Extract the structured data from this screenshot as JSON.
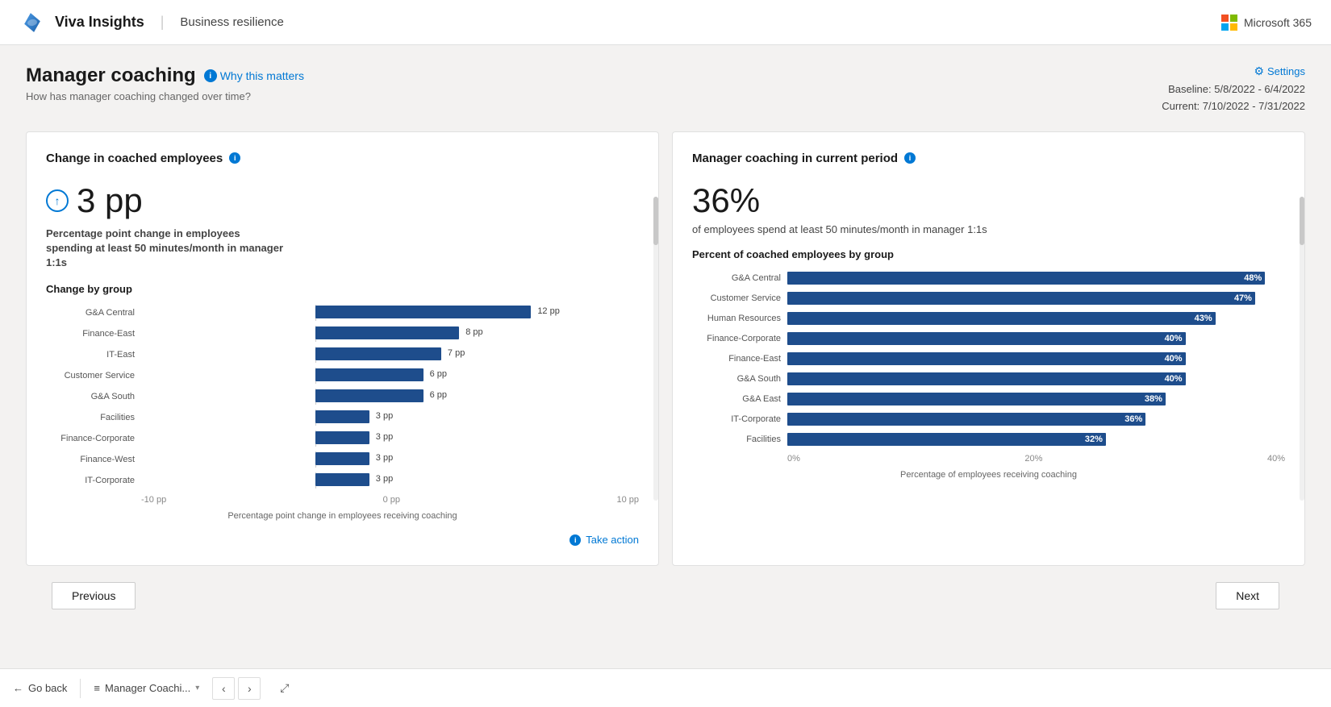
{
  "nav": {
    "app_title": "Viva Insights",
    "section": "Business resilience",
    "ms365_label": "Microsoft 365"
  },
  "header": {
    "title": "Manager coaching",
    "why_matters": "Why this matters",
    "subtitle": "How has manager coaching changed over time?",
    "baseline_label": "Baseline: 5/8/2022 - 6/4/2022",
    "current_label": "Current: 7/10/2022 - 7/31/2022",
    "settings_label": "Settings"
  },
  "left_card": {
    "title": "Change in coached employees",
    "big_value": "3 pp",
    "metric_desc": "Percentage point change in employees spending at least 50 minutes/month in manager 1:1s",
    "change_by_group_title": "Change by group",
    "chart_data": [
      {
        "label": "G&A Central",
        "value": 12,
        "display": "12 pp"
      },
      {
        "label": "Finance-East",
        "value": 8,
        "display": "8 pp"
      },
      {
        "label": "IT-East",
        "value": 7,
        "display": "7 pp"
      },
      {
        "label": "Customer Service",
        "value": 6,
        "display": "6 pp"
      },
      {
        "label": "G&A South",
        "value": 6,
        "display": "6 pp"
      },
      {
        "label": "Facilities",
        "value": 3,
        "display": "3 pp"
      },
      {
        "label": "Finance-Corporate",
        "value": 3,
        "display": "3 pp"
      },
      {
        "label": "Finance-West",
        "value": 3,
        "display": "3 pp"
      },
      {
        "label": "IT-Corporate",
        "value": 3,
        "display": "3 pp"
      }
    ],
    "axis_labels": [
      "-10 pp",
      "0 pp",
      "10 pp"
    ],
    "chart_footer": "Percentage point change in employees receiving coaching",
    "take_action": "Take action"
  },
  "right_card": {
    "title": "Manager coaching in current period",
    "big_percent": "36%",
    "percent_desc": "of employees spend at least 50 minutes/month in manager 1:1s",
    "by_group_title": "Percent of coached employees by group",
    "chart_data": [
      {
        "label": "G&A Central",
        "value": 48,
        "display": "48%"
      },
      {
        "label": "Customer Service",
        "value": 47,
        "display": "47%"
      },
      {
        "label": "Human Resources",
        "value": 43,
        "display": "43%"
      },
      {
        "label": "Finance-Corporate",
        "value": 40,
        "display": "40%"
      },
      {
        "label": "Finance-East",
        "value": 40,
        "display": "40%"
      },
      {
        "label": "G&A South",
        "value": 40,
        "display": "40%"
      },
      {
        "label": "G&A East",
        "value": 38,
        "display": "38%"
      },
      {
        "label": "IT-Corporate",
        "value": 36,
        "display": "36%"
      },
      {
        "label": "Facilities",
        "value": 32,
        "display": "32%"
      }
    ],
    "axis_labels": [
      "0%",
      "20%",
      "40%"
    ],
    "chart_footer": "Percentage of employees receiving coaching"
  },
  "bottom": {
    "prev_label": "Previous",
    "next_label": "Next"
  },
  "footer": {
    "go_back": "Go back",
    "breadcrumb": "Manager Coachi...",
    "expand_title": "Expand"
  }
}
